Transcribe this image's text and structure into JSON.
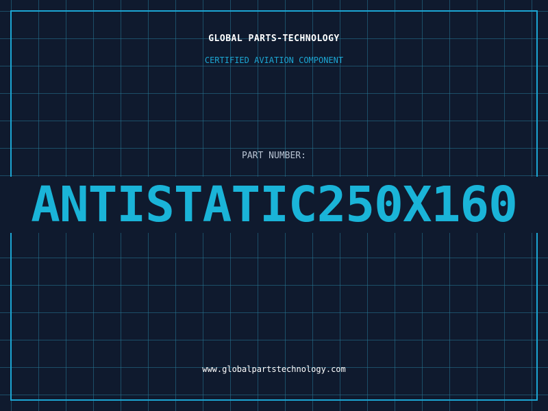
{
  "header": {
    "company": "GLOBAL PARTS-TECHNOLOGY",
    "subtitle": "CERTIFIED AVIATION COMPONENT"
  },
  "part": {
    "label": "PART NUMBER:",
    "number": "ANTISTATIC250X160"
  },
  "footer": {
    "url": "www.globalpartstechnology.com"
  },
  "colors": {
    "background": "#0f1a2e",
    "accent": "#1ca6d3",
    "grid": "#26788f",
    "text": "#ffffff"
  }
}
